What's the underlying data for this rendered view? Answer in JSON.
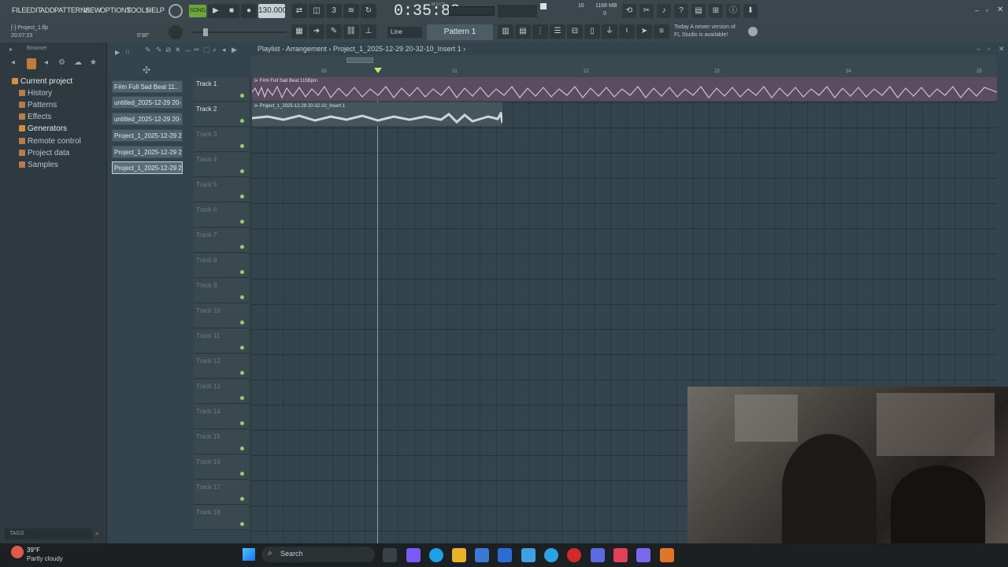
{
  "menu": [
    "FILE",
    "EDIT",
    "ADD",
    "PATTERNS",
    "VIEW",
    "OPTIONS",
    "TOOLS",
    "HELP"
  ],
  "transport": {
    "tempo": "130.000",
    "time": "0:35:88",
    "time_label": "M:S:CS",
    "song_mode": "SONG"
  },
  "monitor": {
    "cpu": "16",
    "ram": "1168 MB",
    "voices": "0"
  },
  "hint": {
    "file": "[-] Project_1.flp",
    "time": "20:07:23",
    "pos": "0'36\""
  },
  "snap": "Line",
  "pattern": "Pattern 1",
  "news": {
    "line1": "Today  A newer version of",
    "line2": "FL Studio is available!"
  },
  "browser": {
    "title": "Browser",
    "items": [
      "Current project",
      "History",
      "Patterns",
      "Effects",
      "Generators",
      "Remote control",
      "Project data",
      "Samples"
    ],
    "tags": "TAGS"
  },
  "patterns": [
    "F#m Full Sad Beat 11..",
    "untitled_2025-12-29 20-..",
    "untitled_2025-12-29 20-..",
    "Project_1_2025-12-29 2..",
    "Project_1_2025-12-29 2..",
    "Project_1_2025-12-29 2.."
  ],
  "playlist": {
    "title": "Playlist - Arrangement",
    "crumb": "Project_1_2025-12-29 20-32-10_Insert 1",
    "bars": [
      "20",
      "21",
      "22",
      "23",
      "24",
      "25"
    ],
    "tracks": [
      "Track 1",
      "Track 2",
      "Track 3",
      "Track 4",
      "Track 5",
      "Track 6",
      "Track 7",
      "Track 8",
      "Track 9",
      "Track 10",
      "Track 11",
      "Track 12",
      "Track 13",
      "Track 14",
      "Track 15",
      "Track 16",
      "Track 17",
      "Track 18",
      "Track 19"
    ],
    "clips": [
      {
        "name": "F#m Full Sad Beat 115Bpm"
      },
      {
        "name": "Project_1_2025-12-29 20-32-10_Insert 1"
      }
    ]
  },
  "weather": {
    "temp": "39°F",
    "desc": "Partly cloudy"
  },
  "taskbar": {
    "search": "Search"
  },
  "colors": {
    "accent_green": "#8fd16c",
    "clip_audio": "#5a4c5e",
    "clip_audio2": "#46545b"
  }
}
